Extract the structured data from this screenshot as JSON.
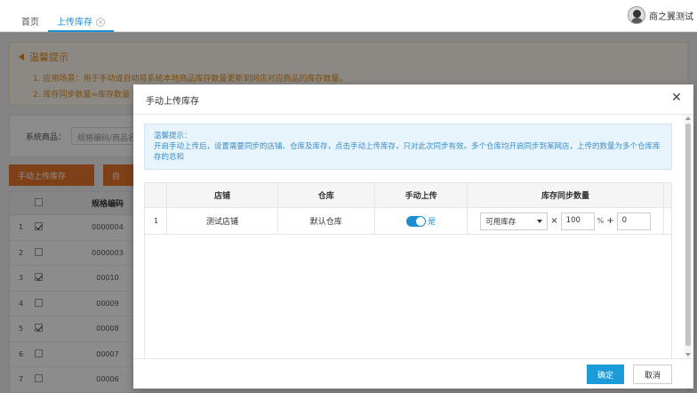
{
  "tabs": [
    {
      "label": "首页"
    },
    {
      "label": "上传库存",
      "close": "×"
    }
  ],
  "user": {
    "name": "商之翼测试"
  },
  "background": {
    "notice_title": "温馨提示",
    "notice_lines": [
      "1. 应用场景：用于手动或自动将系统本地商品库存数量更新到网店对应商品的库存数量。",
      "2. 库存同步数量=库存数量"
    ],
    "filter_label": "系统商品：",
    "filter_placeholder": "规格编码/商品名",
    "upload_button": "手动上传库存",
    "second_button": "自",
    "grid_header": "规格编码",
    "rows": [
      {
        "num": "1",
        "checked": true,
        "code": "0000004"
      },
      {
        "num": "2",
        "checked": false,
        "code": "0000003"
      },
      {
        "num": "3",
        "checked": true,
        "code": "00010"
      },
      {
        "num": "4",
        "checked": false,
        "code": "00009"
      },
      {
        "num": "5",
        "checked": true,
        "code": "00008"
      },
      {
        "num": "6",
        "checked": false,
        "code": "00007"
      },
      {
        "num": "7",
        "checked": false,
        "code": "00006"
      }
    ]
  },
  "modal": {
    "title": "手动上传库存",
    "tip_title": "温馨提示：",
    "tip_body": "开启手动上传后，设置需要同步的店铺、仓库及库存，点击手动上传库存，只对此次同步有效。多个仓库均开启同步到某网店，上传的数量为多个仓库库存的总和",
    "columns": [
      "店铺",
      "仓库",
      "手动上传",
      "库存同步数量"
    ],
    "row": {
      "index": "1",
      "shop": "测试店铺",
      "warehouse": "默认仓库",
      "upload_on": true,
      "upload_text": "是",
      "stock_type": "可用库存",
      "multiply": "×",
      "percent_value": "100",
      "percent_sign": "%",
      "plus": "+",
      "add_value": "0"
    },
    "ok_button": "确定",
    "cancel_button": "取消"
  }
}
